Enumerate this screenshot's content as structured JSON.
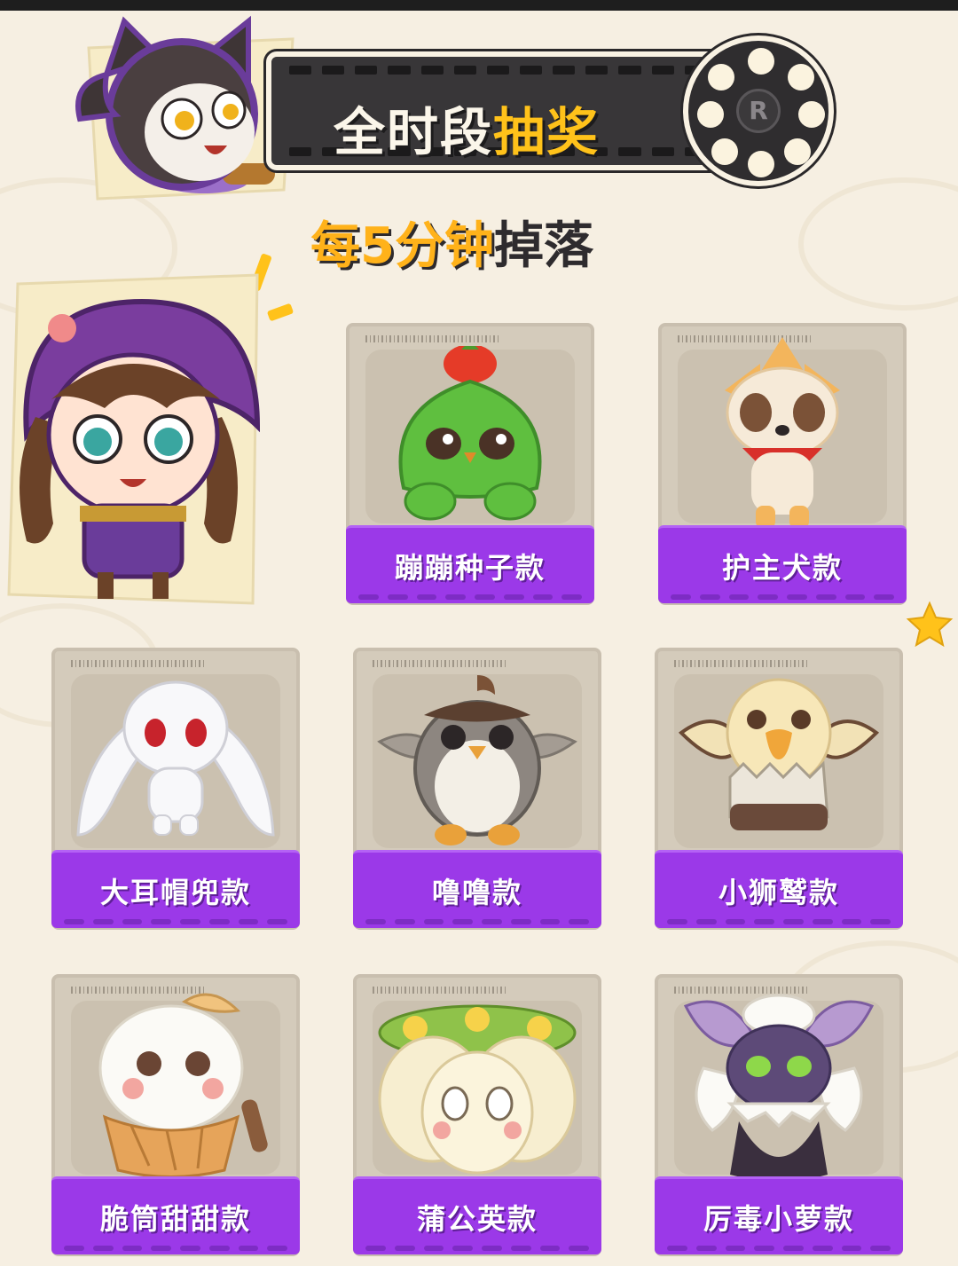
{
  "header": {
    "title_part1": "全时段",
    "title_part2": "抽奖",
    "reel_mark": "R"
  },
  "subtitle": {
    "part1": "每5分钟",
    "part2": "掉落"
  },
  "colors": {
    "background": "#f6efe2",
    "label_purple": "#9b39e8",
    "accent_yellow": "#ffc21a",
    "film_dark": "#383638"
  },
  "items": [
    {
      "label": "蹦蹦种子款",
      "icon": "green-cactus-plush-icon"
    },
    {
      "label": "护主犬款",
      "icon": "fox-dog-plush-icon"
    },
    {
      "label": "大耳帽兜款",
      "icon": "white-bunny-plush-icon"
    },
    {
      "label": "噜噜款",
      "icon": "grey-owl-plush-icon"
    },
    {
      "label": "小狮鹫款",
      "icon": "griffin-chick-plush-icon"
    },
    {
      "label": "脆筒甜甜款",
      "icon": "ice-cream-cone-plush-icon"
    },
    {
      "label": "蒲公英款",
      "icon": "dandelion-plush-icon"
    },
    {
      "label": "厉毒小萝款",
      "icon": "purple-flower-creature-plush-icon"
    }
  ]
}
